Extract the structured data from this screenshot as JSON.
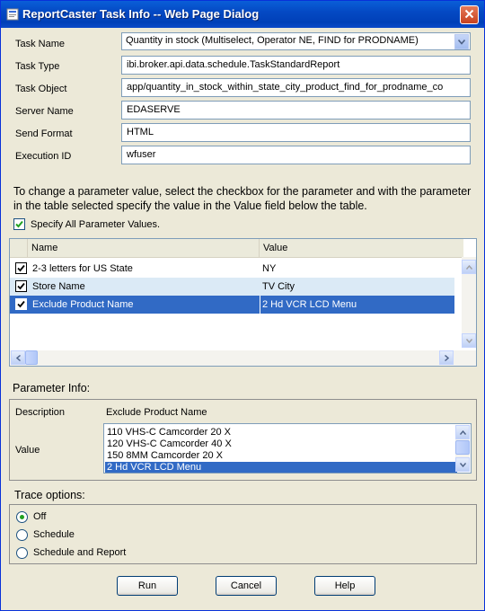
{
  "window": {
    "title": "ReportCaster Task Info -- Web Page Dialog"
  },
  "task_fields": [
    {
      "label": "Task Name",
      "value": "Quantity in stock (Multiselect, Operator NE, FIND for PRODNAME)"
    },
    {
      "label": "Task Type",
      "value": "ibi.broker.api.data.schedule.TaskStandardReport"
    },
    {
      "label": "Task Object",
      "value": "app/quantity_in_stock_within_state_city_product_find_for_prodname_co"
    },
    {
      "label": "Server Name",
      "value": "EDASERVE"
    },
    {
      "label": "Send Format",
      "value": "HTML"
    },
    {
      "label": "Execution ID",
      "value": "wfuser"
    }
  ],
  "instructions": "To change a parameter value, select the checkbox for the parameter and with the parameter in the table selected specify the value in the Value field below the table.",
  "specify_all": {
    "label": "Specify All Parameter Values.",
    "checked": true
  },
  "param_table": {
    "columns": [
      "Name",
      "Value"
    ],
    "rows": [
      {
        "name": "2-3 letters for US State",
        "value": "NY",
        "checked": true,
        "state": "normal"
      },
      {
        "name": "Store Name",
        "value": "TV City",
        "checked": true,
        "state": "hover"
      },
      {
        "name": "Exclude Product Name",
        "value": "2 Hd VCR LCD Menu",
        "checked": true,
        "state": "selected"
      }
    ]
  },
  "param_info": {
    "title": "Parameter Info:",
    "description_label": "Description",
    "description_value": "Exclude Product Name",
    "value_label": "Value",
    "value_options": [
      {
        "text": "110 VHS-C Camcorder 20 X",
        "selected": false
      },
      {
        "text": "120 VHS-C Camcorder 40 X",
        "selected": false
      },
      {
        "text": "150 8MM Camcorder 20 X",
        "selected": false
      },
      {
        "text": "2 Hd VCR LCD Menu",
        "selected": true
      }
    ]
  },
  "trace": {
    "title": "Trace options:",
    "options": [
      {
        "label": "Off",
        "selected": true
      },
      {
        "label": "Schedule",
        "selected": false
      },
      {
        "label": "Schedule and Report",
        "selected": false
      }
    ]
  },
  "buttons": {
    "run": "Run",
    "cancel": "Cancel",
    "help": "Help"
  },
  "colors": {
    "titlebar": "#0449c4",
    "dialog_bg": "#ece9d8",
    "selection": "#316ac5",
    "hover_row": "#dbeaf6",
    "radio_dot": "#21a121"
  },
  "icons": {
    "title": "reportcaster-app-icon",
    "close": "close-icon",
    "dropdown": "chevron-down-icon",
    "scroll_up": "arrow-up-icon",
    "scroll_down": "arrow-down-icon",
    "scroll_left": "arrow-left-icon",
    "scroll_right": "arrow-right-icon"
  }
}
